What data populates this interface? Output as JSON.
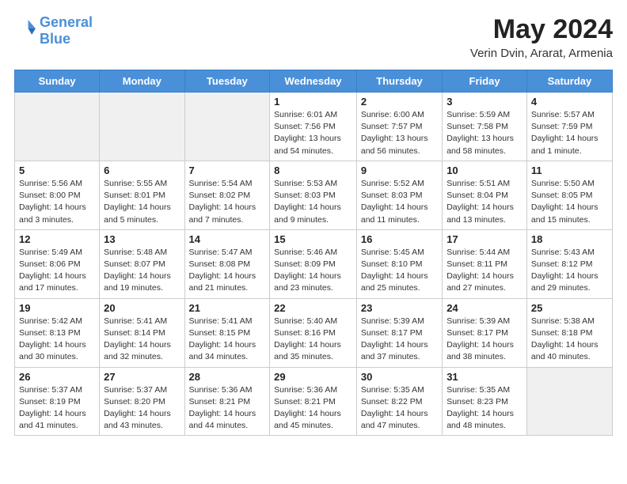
{
  "header": {
    "logo_line1": "General",
    "logo_line2": "Blue",
    "month": "May 2024",
    "location": "Verin Dvin, Ararat, Armenia"
  },
  "weekdays": [
    "Sunday",
    "Monday",
    "Tuesday",
    "Wednesday",
    "Thursday",
    "Friday",
    "Saturday"
  ],
  "weeks": [
    [
      {
        "day": "",
        "info": "",
        "empty": true
      },
      {
        "day": "",
        "info": "",
        "empty": true
      },
      {
        "day": "",
        "info": "",
        "empty": true
      },
      {
        "day": "1",
        "info": "Sunrise: 6:01 AM\nSunset: 7:56 PM\nDaylight: 13 hours\nand 54 minutes.",
        "empty": false
      },
      {
        "day": "2",
        "info": "Sunrise: 6:00 AM\nSunset: 7:57 PM\nDaylight: 13 hours\nand 56 minutes.",
        "empty": false
      },
      {
        "day": "3",
        "info": "Sunrise: 5:59 AM\nSunset: 7:58 PM\nDaylight: 13 hours\nand 58 minutes.",
        "empty": false
      },
      {
        "day": "4",
        "info": "Sunrise: 5:57 AM\nSunset: 7:59 PM\nDaylight: 14 hours\nand 1 minute.",
        "empty": false
      }
    ],
    [
      {
        "day": "5",
        "info": "Sunrise: 5:56 AM\nSunset: 8:00 PM\nDaylight: 14 hours\nand 3 minutes.",
        "empty": false
      },
      {
        "day": "6",
        "info": "Sunrise: 5:55 AM\nSunset: 8:01 PM\nDaylight: 14 hours\nand 5 minutes.",
        "empty": false
      },
      {
        "day": "7",
        "info": "Sunrise: 5:54 AM\nSunset: 8:02 PM\nDaylight: 14 hours\nand 7 minutes.",
        "empty": false
      },
      {
        "day": "8",
        "info": "Sunrise: 5:53 AM\nSunset: 8:03 PM\nDaylight: 14 hours\nand 9 minutes.",
        "empty": false
      },
      {
        "day": "9",
        "info": "Sunrise: 5:52 AM\nSunset: 8:03 PM\nDaylight: 14 hours\nand 11 minutes.",
        "empty": false
      },
      {
        "day": "10",
        "info": "Sunrise: 5:51 AM\nSunset: 8:04 PM\nDaylight: 14 hours\nand 13 minutes.",
        "empty": false
      },
      {
        "day": "11",
        "info": "Sunrise: 5:50 AM\nSunset: 8:05 PM\nDaylight: 14 hours\nand 15 minutes.",
        "empty": false
      }
    ],
    [
      {
        "day": "12",
        "info": "Sunrise: 5:49 AM\nSunset: 8:06 PM\nDaylight: 14 hours\nand 17 minutes.",
        "empty": false
      },
      {
        "day": "13",
        "info": "Sunrise: 5:48 AM\nSunset: 8:07 PM\nDaylight: 14 hours\nand 19 minutes.",
        "empty": false
      },
      {
        "day": "14",
        "info": "Sunrise: 5:47 AM\nSunset: 8:08 PM\nDaylight: 14 hours\nand 21 minutes.",
        "empty": false
      },
      {
        "day": "15",
        "info": "Sunrise: 5:46 AM\nSunset: 8:09 PM\nDaylight: 14 hours\nand 23 minutes.",
        "empty": false
      },
      {
        "day": "16",
        "info": "Sunrise: 5:45 AM\nSunset: 8:10 PM\nDaylight: 14 hours\nand 25 minutes.",
        "empty": false
      },
      {
        "day": "17",
        "info": "Sunrise: 5:44 AM\nSunset: 8:11 PM\nDaylight: 14 hours\nand 27 minutes.",
        "empty": false
      },
      {
        "day": "18",
        "info": "Sunrise: 5:43 AM\nSunset: 8:12 PM\nDaylight: 14 hours\nand 29 minutes.",
        "empty": false
      }
    ],
    [
      {
        "day": "19",
        "info": "Sunrise: 5:42 AM\nSunset: 8:13 PM\nDaylight: 14 hours\nand 30 minutes.",
        "empty": false
      },
      {
        "day": "20",
        "info": "Sunrise: 5:41 AM\nSunset: 8:14 PM\nDaylight: 14 hours\nand 32 minutes.",
        "empty": false
      },
      {
        "day": "21",
        "info": "Sunrise: 5:41 AM\nSunset: 8:15 PM\nDaylight: 14 hours\nand 34 minutes.",
        "empty": false
      },
      {
        "day": "22",
        "info": "Sunrise: 5:40 AM\nSunset: 8:16 PM\nDaylight: 14 hours\nand 35 minutes.",
        "empty": false
      },
      {
        "day": "23",
        "info": "Sunrise: 5:39 AM\nSunset: 8:17 PM\nDaylight: 14 hours\nand 37 minutes.",
        "empty": false
      },
      {
        "day": "24",
        "info": "Sunrise: 5:39 AM\nSunset: 8:17 PM\nDaylight: 14 hours\nand 38 minutes.",
        "empty": false
      },
      {
        "day": "25",
        "info": "Sunrise: 5:38 AM\nSunset: 8:18 PM\nDaylight: 14 hours\nand 40 minutes.",
        "empty": false
      }
    ],
    [
      {
        "day": "26",
        "info": "Sunrise: 5:37 AM\nSunset: 8:19 PM\nDaylight: 14 hours\nand 41 minutes.",
        "empty": false
      },
      {
        "day": "27",
        "info": "Sunrise: 5:37 AM\nSunset: 8:20 PM\nDaylight: 14 hours\nand 43 minutes.",
        "empty": false
      },
      {
        "day": "28",
        "info": "Sunrise: 5:36 AM\nSunset: 8:21 PM\nDaylight: 14 hours\nand 44 minutes.",
        "empty": false
      },
      {
        "day": "29",
        "info": "Sunrise: 5:36 AM\nSunset: 8:21 PM\nDaylight: 14 hours\nand 45 minutes.",
        "empty": false
      },
      {
        "day": "30",
        "info": "Sunrise: 5:35 AM\nSunset: 8:22 PM\nDaylight: 14 hours\nand 47 minutes.",
        "empty": false
      },
      {
        "day": "31",
        "info": "Sunrise: 5:35 AM\nSunset: 8:23 PM\nDaylight: 14 hours\nand 48 minutes.",
        "empty": false
      },
      {
        "day": "",
        "info": "",
        "empty": true
      }
    ]
  ]
}
